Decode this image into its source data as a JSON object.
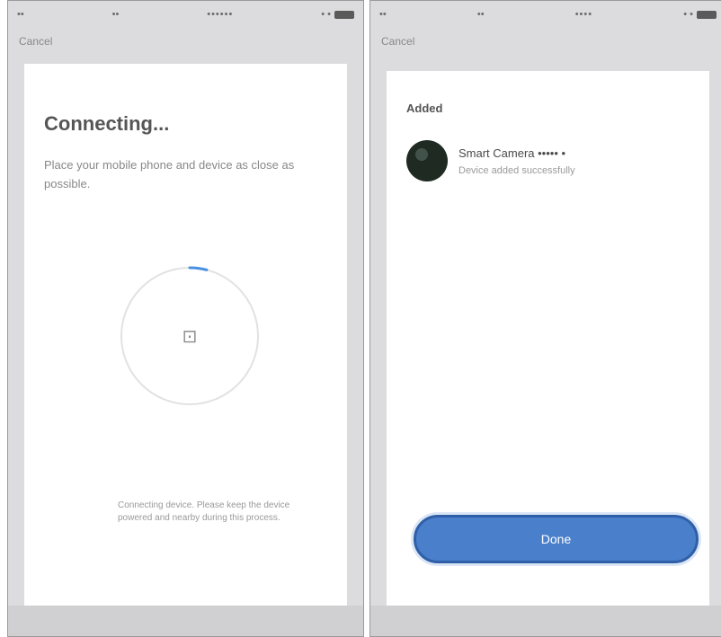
{
  "left_screen": {
    "status_bar": {
      "left": "••",
      "center": "••",
      "time": "••••••",
      "right": "• •"
    },
    "nav": {
      "back_label": "Cancel"
    },
    "title": "Connecting...",
    "description": "Place your mobile phone and device as close as possible.",
    "progress": {
      "fraction": 0.04,
      "accent_color": "#4a90e2"
    },
    "center_icon": "router-icon",
    "center_glyph": "⊡",
    "note": "Connecting device. Please keep the device powered and nearby during this process."
  },
  "right_screen": {
    "status_bar": {
      "left": "••",
      "center": "••",
      "time": "••••",
      "right": "• •"
    },
    "nav": {
      "back_label": "Cancel"
    },
    "header": "Added",
    "device": {
      "name": "Smart Camera ••••• •",
      "subtitle": "Device added successfully",
      "icon": "camera-icon"
    },
    "button_label": "Done",
    "button_color": "#4a7fcb"
  }
}
